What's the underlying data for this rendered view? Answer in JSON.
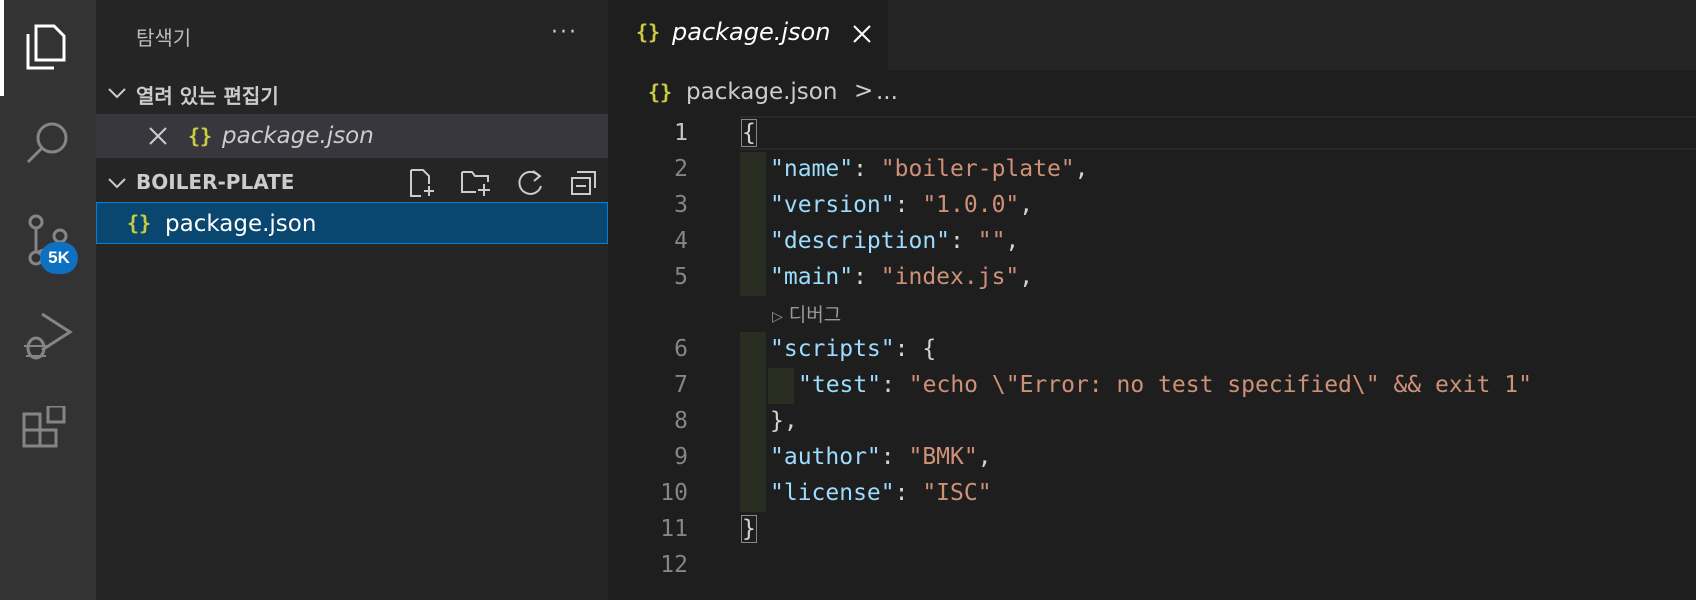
{
  "activity_bar": {
    "items": [
      {
        "icon": "files-icon",
        "active": true
      },
      {
        "icon": "search-icon"
      },
      {
        "icon": "source-control-icon",
        "badge": "5K"
      },
      {
        "icon": "run-debug-icon"
      },
      {
        "icon": "extensions-icon"
      }
    ],
    "accent": "#0e70c0"
  },
  "sidebar": {
    "title": "탐색기",
    "more": "···",
    "open_editors": {
      "label": "열려 있는 편집기",
      "items": [
        {
          "icon": "{}",
          "name": "package.json"
        }
      ]
    },
    "folder": {
      "label": "BOILER-PLATE",
      "actions": [
        "new-file-icon",
        "new-folder-icon",
        "refresh-icon",
        "collapse-all-icon"
      ],
      "items": [
        {
          "icon": "{}",
          "name": "package.json"
        }
      ]
    }
  },
  "editor": {
    "tab": {
      "icon": "{}",
      "name": "package.json"
    },
    "breadcrumb": {
      "icon": "{}",
      "file": "package.json",
      "separator": ">",
      "more": "..."
    },
    "codelens": "디버그",
    "lines": [
      {
        "n": "1",
        "text": "{"
      },
      {
        "n": "2",
        "key": "\"name\"",
        "value": "\"boiler-plate\"",
        "end": ","
      },
      {
        "n": "3",
        "key": "\"version\"",
        "value": "\"1.0.0\"",
        "end": ","
      },
      {
        "n": "4",
        "key": "\"description\"",
        "value": "\"\"",
        "end": ","
      },
      {
        "n": "5",
        "key": "\"main\"",
        "value": "\"index.js\"",
        "end": ","
      },
      {
        "n": "6",
        "key": "\"scripts\"",
        "value": "{",
        "end": ""
      },
      {
        "n": "7",
        "key": "\"test\"",
        "value": "\"echo \\\"Error: no test specified\\\" && exit 1\"",
        "end": ""
      },
      {
        "n": "8",
        "text": "},"
      },
      {
        "n": "9",
        "key": "\"author\"",
        "value": "\"BMK\"",
        "end": ","
      },
      {
        "n": "10",
        "key": "\"license\"",
        "value": "\"ISC\"",
        "end": ""
      },
      {
        "n": "11",
        "text": "}"
      },
      {
        "n": "12",
        "text": ""
      }
    ]
  }
}
